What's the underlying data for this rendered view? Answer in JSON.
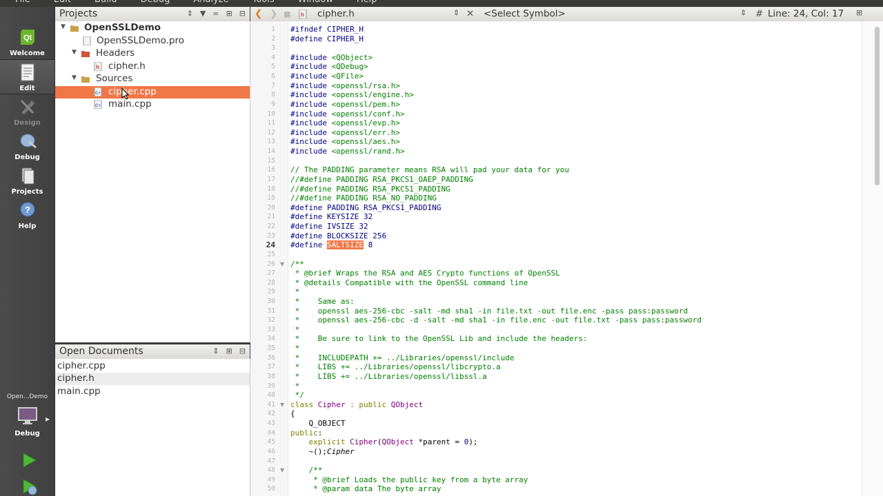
{
  "menu": [
    "File",
    "Edit",
    "Build",
    "Debug",
    "Analyze",
    "Tools",
    "Window",
    "Help"
  ],
  "modes": [
    {
      "label": "Welcome",
      "icon": "qt-logo-icon"
    },
    {
      "label": "Edit",
      "icon": "edit-document-icon"
    },
    {
      "label": "Design",
      "icon": "design-pencil-icon"
    },
    {
      "label": "Debug",
      "icon": "debug-bug-icon"
    },
    {
      "label": "Projects",
      "icon": "projects-icon"
    },
    {
      "label": "Help",
      "icon": "help-icon"
    }
  ],
  "kit": {
    "project": "Open...Demo",
    "label": "Debug"
  },
  "projects_pane": {
    "title": "Projects",
    "tree": [
      {
        "label": "OpenSSLDemo",
        "icon": "project-folder-icon"
      },
      {
        "label": "OpenSSLDemo.pro",
        "icon": "pro-file-icon"
      },
      {
        "label": "Headers",
        "icon": "headers-folder-icon"
      },
      {
        "label": "cipher.h",
        "icon": "header-file-icon"
      },
      {
        "label": "Sources",
        "icon": "sources-folder-icon"
      },
      {
        "label": "cipher.cpp",
        "icon": "cpp-file-icon"
      },
      {
        "label": "main.cpp",
        "icon": "cpp-file-icon"
      }
    ]
  },
  "open_documents": {
    "title": "Open Documents",
    "items": [
      "cipher.cpp",
      "cipher.h",
      "main.cpp"
    ]
  },
  "editor_toolbar": {
    "file": "cipher.h",
    "symbol": "<Select Symbol>",
    "position": "Line: 24, Col: 17"
  },
  "editor": {
    "current_line": 24,
    "lines": [
      {
        "n": "1",
        "t": "#ifndef CIPHER_H"
      },
      {
        "n": "2",
        "t": "#define CIPHER_H"
      },
      {
        "n": "3",
        "t": ""
      },
      {
        "n": "4",
        "a": "#include ",
        "b": "<QObject>"
      },
      {
        "n": "5",
        "a": "#include ",
        "b": "<QDebug>"
      },
      {
        "n": "6",
        "a": "#include ",
        "b": "<QFile>"
      },
      {
        "n": "7",
        "a": "#include ",
        "b": "<openssl/rsa.h>"
      },
      {
        "n": "8",
        "a": "#include ",
        "b": "<openssl/engine.h>"
      },
      {
        "n": "9",
        "a": "#include ",
        "b": "<openssl/pem.h>"
      },
      {
        "n": "10",
        "a": "#include ",
        "b": "<openssl/conf.h>"
      },
      {
        "n": "11",
        "a": "#include ",
        "b": "<openssl/evp.h>"
      },
      {
        "n": "12",
        "a": "#include ",
        "b": "<openssl/err.h>"
      },
      {
        "n": "13",
        "a": "#include ",
        "b": "<openssl/aes.h>"
      },
      {
        "n": "14",
        "a": "#include ",
        "b": "<openssl/rand.h>"
      },
      {
        "n": "15",
        "t": ""
      },
      {
        "n": "16",
        "c": "// The PADDING parameter means RSA will pad your data for you"
      },
      {
        "n": "17",
        "c": "//#define PADDING RSA_PKCS1_OAEP_PADDING"
      },
      {
        "n": "18",
        "c": "//#define PADDING RSA_PKCS1_PADDING"
      },
      {
        "n": "19",
        "c": "//#define PADDING RSA_NO_PADDING"
      },
      {
        "n": "20",
        "t": "#define PADDING RSA_PKCS1_PADDING"
      },
      {
        "n": "21",
        "t": "#define KEYSIZE 32"
      },
      {
        "n": "22",
        "t": "#define IVSIZE 32"
      },
      {
        "n": "23",
        "t": "#define BLOCKSIZE 256"
      },
      {
        "n": "24",
        "a": "#define ",
        "h": "SALTSIZE",
        "b": " 8"
      },
      {
        "n": "25",
        "t": ""
      },
      {
        "n": "26",
        "c": "/**"
      },
      {
        "n": "27",
        "c": " * @brief Wraps the RSA and AES Crypto functions of OpenSSL"
      },
      {
        "n": "28",
        "c": " * @details Compatible with the OpenSSL command line"
      },
      {
        "n": "29",
        "c": " *"
      },
      {
        "n": "30",
        "c": " *    Same as:"
      },
      {
        "n": "31",
        "c": " *    openssl aes-256-cbc -salt -md sha1 -in file.txt -out file.enc -pass pass:password"
      },
      {
        "n": "32",
        "c": " *    openssl aes-256-cbc -d -salt -md sha1 -in file.enc -out file.txt -pass pass:password"
      },
      {
        "n": "33",
        "c": " *"
      },
      {
        "n": "34",
        "c": " *    Be sure to link to the OpenSSL Lib and include the headers:"
      },
      {
        "n": "35",
        "c": " *"
      },
      {
        "n": "36",
        "c": " *    INCLUDEPATH += ../Libraries/openssl/include"
      },
      {
        "n": "37",
        "c": " *    LIBS += ../Libraries/openssl/libcrypto.a"
      },
      {
        "n": "38",
        "c": " *    LIBS += ../Libraries/openssl/libssl.a"
      },
      {
        "n": "39",
        "c": " *"
      },
      {
        "n": "40",
        "c": " */"
      },
      {
        "n": "41",
        "k": "class ",
        "y": "Cipher",
        "k2": " : public ",
        "y2": "QObject"
      },
      {
        "n": "42",
        "t": "{"
      },
      {
        "n": "43",
        "t": "    Q_OBJECT"
      },
      {
        "n": "44",
        "k": "public",
        "t": ":"
      },
      {
        "n": "45",
        "k": "    explicit ",
        "y": "Cipher",
        "t": "(",
        "y2": "QObject",
        "t2": " *parent = ",
        "num": "0",
        "t3": ");"
      },
      {
        "n": "46",
        "t": "    ~",
        "i": "Cipher",
        "t2": "();"
      },
      {
        "n": "47",
        "t": ""
      },
      {
        "n": "48",
        "c": "    /**"
      },
      {
        "n": "49",
        "c": "     * @brief Loads the public key from a byte array"
      },
      {
        "n": "50",
        "c": "     * @param data The byte array"
      }
    ]
  }
}
